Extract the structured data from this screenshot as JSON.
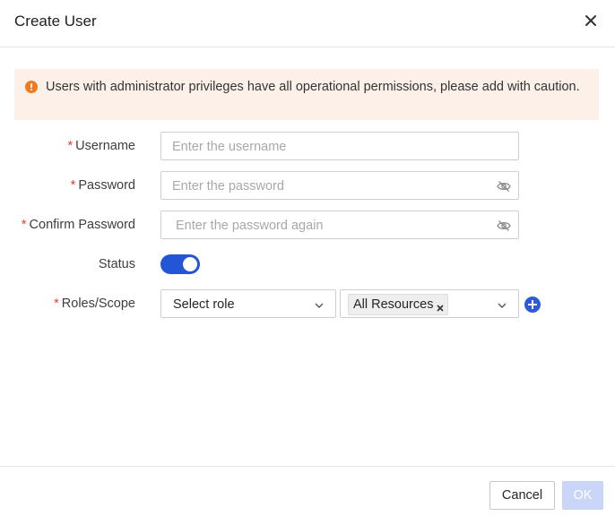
{
  "dialog": {
    "title": "Create User"
  },
  "alert": {
    "icon": "warning-icon",
    "color": "#f07a22",
    "text": "Users with administrator privileges have all operational permissions, please add with caution."
  },
  "form": {
    "username": {
      "required": "*",
      "label": "Username",
      "placeholder": "Enter the username",
      "value": ""
    },
    "password": {
      "required": "*",
      "label": "Password",
      "placeholder": "Enter the password",
      "value": "",
      "icon": "eye-hidden-icon"
    },
    "confirm_password": {
      "required": "*",
      "label": "Confirm Password",
      "placeholder": "Enter the password again",
      "value": "",
      "icon": "eye-hidden-icon"
    },
    "status": {
      "label": "Status",
      "enabled": true,
      "color": "#2256d6"
    },
    "roles_scope": {
      "required": "*",
      "label": "Roles/Scope",
      "role_select": {
        "value": "Select role"
      },
      "scope_select": {
        "tags": [
          "All Resources"
        ]
      },
      "add_icon": "plus-circle-icon"
    }
  },
  "footer": {
    "cancel_label": "Cancel",
    "ok_label": "OK"
  },
  "colors": {
    "primary": "#2256d6",
    "required": "#e23c39",
    "alert_bg": "#fdf0e8"
  }
}
